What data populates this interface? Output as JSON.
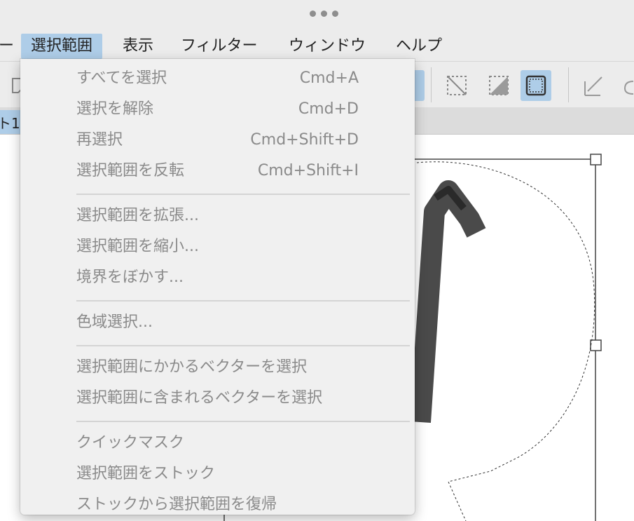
{
  "menubar": {
    "items": [
      {
        "label": "ー"
      },
      {
        "label": "選択範囲"
      },
      {
        "label": "表示"
      },
      {
        "label": "フィルター"
      },
      {
        "label": "ウィンドウ"
      },
      {
        "label": "ヘルプ"
      }
    ]
  },
  "tab": {
    "label": "ト1"
  },
  "toolbar": {
    "icons": [
      "note-icon",
      "selection-clear-icon",
      "selection-toggle-icon",
      "selection-marquee-icon",
      "pen-selection-icon",
      "lasso-icon"
    ],
    "selected": "selection-marquee-icon",
    "accent": "#aecde8"
  },
  "menu": {
    "groups": [
      [
        {
          "label": "すべてを選択",
          "shortcut": "Cmd+A"
        },
        {
          "label": "選択を解除",
          "shortcut": "Cmd+D"
        },
        {
          "label": "再選択",
          "shortcut": "Cmd+Shift+D"
        },
        {
          "label": "選択範囲を反転",
          "shortcut": "Cmd+Shift+I"
        }
      ],
      [
        {
          "label": "選択範囲を拡張...",
          "shortcut": ""
        },
        {
          "label": "選択範囲を縮小...",
          "shortcut": ""
        },
        {
          "label": "境界をぼかす...",
          "shortcut": ""
        }
      ],
      [
        {
          "label": "色域選択...",
          "shortcut": ""
        }
      ],
      [
        {
          "label": "選択範囲にかかるベクターを選択",
          "shortcut": ""
        },
        {
          "label": "選択範囲に含まれるベクターを選択",
          "shortcut": ""
        }
      ],
      [
        {
          "label": "クイックマスク",
          "shortcut": ""
        },
        {
          "label": "選択範囲をストック",
          "shortcut": ""
        },
        {
          "label": "ストックから選択範囲を復帰",
          "shortcut": ""
        }
      ]
    ]
  }
}
